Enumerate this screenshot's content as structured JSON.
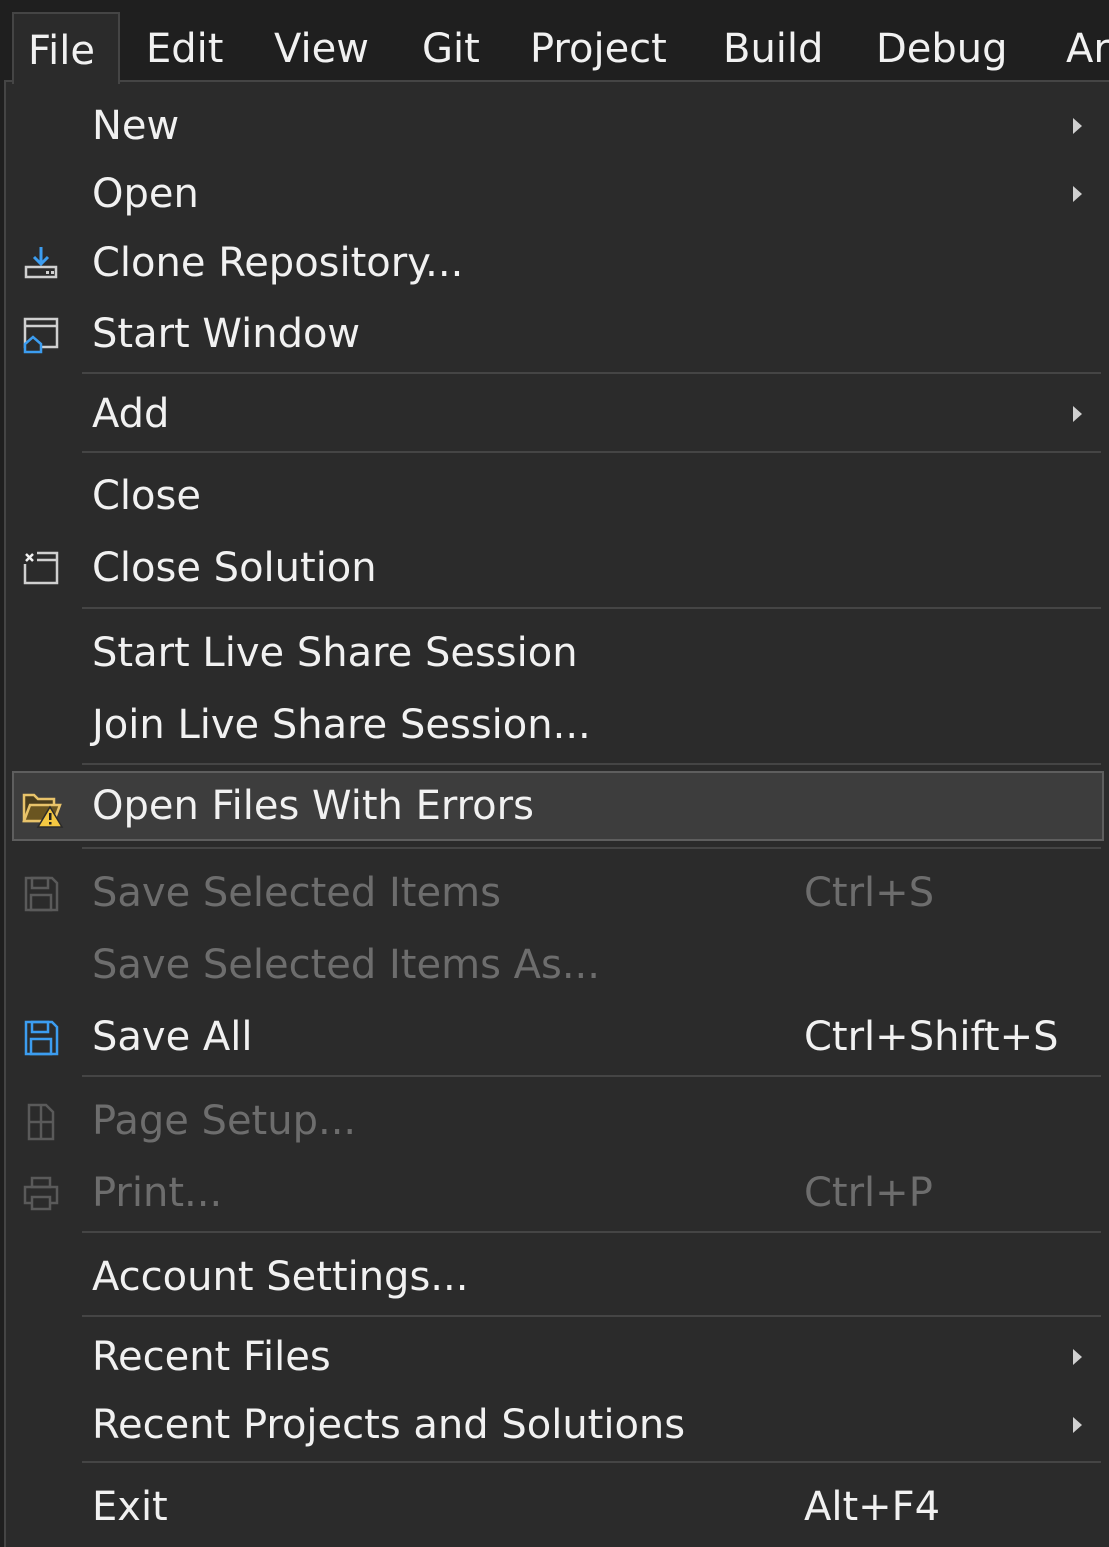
{
  "menubar": {
    "items": [
      {
        "label": "File",
        "mnemonic": "F"
      },
      {
        "label": "Edit",
        "mnemonic": "E"
      },
      {
        "label": "View",
        "mnemonic": "V"
      },
      {
        "label": "Git",
        "mnemonic": "G"
      },
      {
        "label": "Project",
        "mnemonic": "P"
      },
      {
        "label": "Build",
        "mnemonic": "B"
      },
      {
        "label": "Debug",
        "mnemonic": "D"
      },
      {
        "label": "Ar",
        "mnemonic": ""
      }
    ]
  },
  "file_menu": {
    "new": {
      "label": "New",
      "mnemonic": "N"
    },
    "open": {
      "label": "Open",
      "mnemonic": "O"
    },
    "clone": {
      "label": "Clone Repository...",
      "icon": "clone-download-icon",
      "mnemonic": "e"
    },
    "start_window": {
      "label": "Start Window",
      "icon": "start-window-icon",
      "mnemonic": "W"
    },
    "add": {
      "label": "Add",
      "mnemonic": "d"
    },
    "close": {
      "label": "Close",
      "mnemonic": "C"
    },
    "close_solution": {
      "label": "Close Solution",
      "icon": "close-solution-icon",
      "mnemonic": "t"
    },
    "start_live_share": {
      "label": "Start Live Share Session"
    },
    "join_live_share": {
      "label": "Join Live Share Session..."
    },
    "open_files_errors": {
      "label": "Open Files With Errors",
      "icon": "folder-warning-icon"
    },
    "save_selected": {
      "label": "Save Selected Items",
      "shortcut": "Ctrl+S",
      "icon": "save-icon",
      "mnemonic": "S"
    },
    "save_selected_as": {
      "label": "Save Selected Items As...",
      "mnemonic": "A"
    },
    "save_all": {
      "label": "Save All",
      "shortcut": "Ctrl+Shift+S",
      "icon": "save-all-icon",
      "mnemonic": "l"
    },
    "page_setup": {
      "label": "Page Setup...",
      "icon": "page-setup-icon",
      "mnemonic": "u"
    },
    "print": {
      "label": "Print...",
      "shortcut": "Ctrl+P",
      "icon": "print-icon",
      "mnemonic": "P"
    },
    "account_settings": {
      "label": "Account Settings...",
      "mnemonic": "i"
    },
    "recent_files": {
      "label": "Recent Files",
      "mnemonic": "F"
    },
    "recent_projects": {
      "label": "Recent Projects and Solutions",
      "mnemonic": "j"
    },
    "exit": {
      "label": "Exit",
      "shortcut": "Alt+F4",
      "mnemonic": "x"
    }
  },
  "colors": {
    "menu_bg": "#2b2b2b",
    "menubar_bg": "#1f1f1f",
    "text": "#f1f1f1",
    "disabled_text": "#6d6d6d",
    "highlight_bg": "#3d3d3d",
    "accent_blue": "#3c9df0",
    "warning_yellow": "#f4c842"
  }
}
